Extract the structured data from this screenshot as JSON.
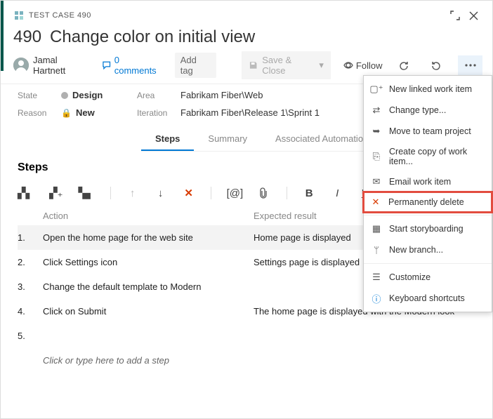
{
  "header": {
    "type_label": "TEST CASE 490",
    "id": "490",
    "title": "Change color on initial view"
  },
  "author": {
    "name": "Jamal Hartnett"
  },
  "comments": {
    "count_label": "0 comments"
  },
  "actions": {
    "add_tag": "Add tag",
    "save_close": "Save & Close",
    "follow": "Follow"
  },
  "fields": {
    "state_label": "State",
    "state_value": "Design",
    "reason_label": "Reason",
    "reason_value": "New",
    "area_label": "Area",
    "area_value": "Fabrikam Fiber\\Web",
    "iteration_label": "Iteration",
    "iteration_value": "Fabrikam Fiber\\Release 1\\Sprint 1"
  },
  "tabs": {
    "steps": "Steps",
    "summary": "Summary",
    "automation": "Associated Automation"
  },
  "steps": {
    "heading": "Steps",
    "col_action": "Action",
    "col_expected": "Expected result",
    "rows": [
      {
        "num": "1.",
        "action": "Open the home page for the web site",
        "expected": "Home page is displayed"
      },
      {
        "num": "2.",
        "action": "Click Settings icon",
        "expected": "Settings page is displayed"
      },
      {
        "num": "3.",
        "action": "Change the default template to Modern",
        "expected": ""
      },
      {
        "num": "4.",
        "action": "Click on Submit",
        "expected": "The home page is displayed with the Modern look"
      },
      {
        "num": "5.",
        "action": "",
        "expected": ""
      }
    ],
    "placeholder": "Click or type here to add a step"
  },
  "menu": {
    "new_linked": "New linked work item",
    "change_type": "Change type...",
    "move": "Move to team project",
    "copy": "Create copy of work item...",
    "email": "Email work item",
    "delete": "Permanently delete",
    "storyboard": "Start storyboarding",
    "branch": "New branch...",
    "customize": "Customize",
    "shortcuts": "Keyboard shortcuts"
  }
}
